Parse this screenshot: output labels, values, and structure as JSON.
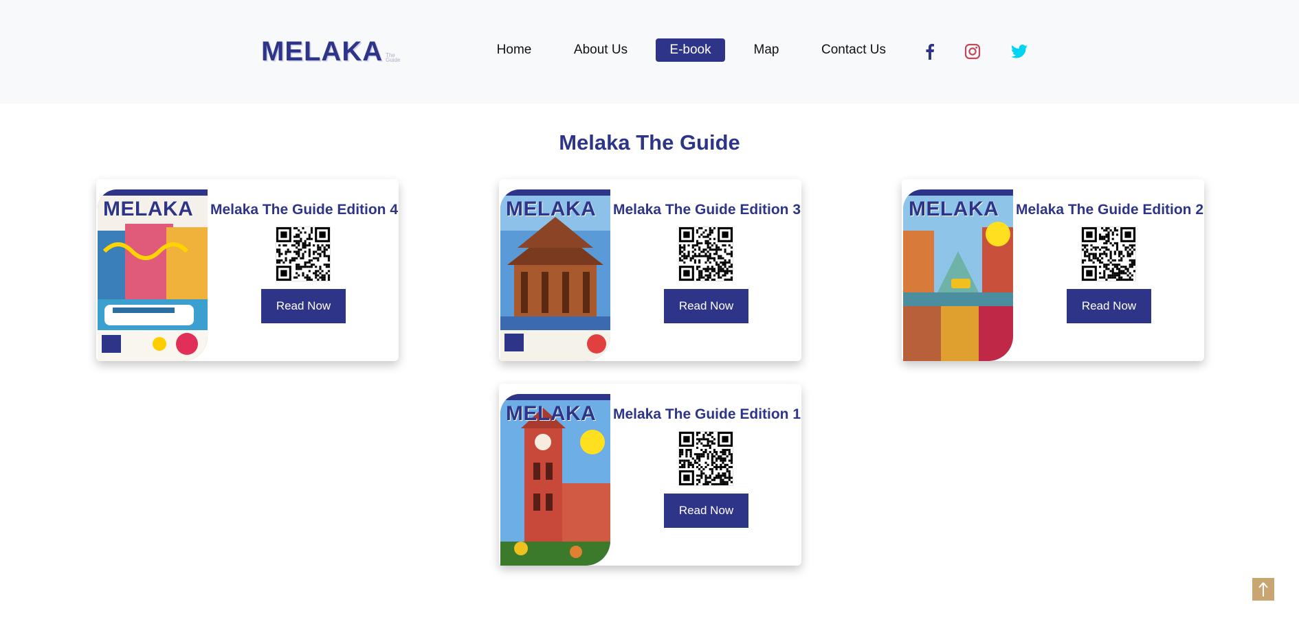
{
  "header": {
    "logo_text": "MELAKA",
    "logo_sub": "The Guide",
    "nav": [
      {
        "label": "Home",
        "active": false
      },
      {
        "label": "About Us",
        "active": false
      },
      {
        "label": "E-book",
        "active": true
      },
      {
        "label": "Map",
        "active": false
      },
      {
        "label": "Contact Us",
        "active": false
      }
    ],
    "social": [
      {
        "icon": "facebook-icon",
        "color": "#2e3488"
      },
      {
        "icon": "instagram-icon",
        "color": "#c13584"
      },
      {
        "icon": "twitter-icon",
        "color": "#1da1f2"
      }
    ]
  },
  "main": {
    "title": "Melaka The Guide",
    "cards": [
      {
        "title": "Melaka The Guide Edition 4",
        "button": "Read Now",
        "cover_text": "MELAKA"
      },
      {
        "title": "Melaka The Guide Edition 3",
        "button": "Read Now",
        "cover_text": "MELAKA"
      },
      {
        "title": "Melaka The Guide Edition 2",
        "button": "Read Now",
        "cover_text": "MELAKA"
      },
      {
        "title": "Melaka The Guide Edition 1",
        "button": "Read Now",
        "cover_text": "MELAKA"
      }
    ]
  },
  "colors": {
    "primary": "#2e3488",
    "header_bg": "#f8f9fa",
    "scroll_top_bg": "#c9a571"
  },
  "scroll_top": {
    "icon": "arrow-up-icon"
  }
}
